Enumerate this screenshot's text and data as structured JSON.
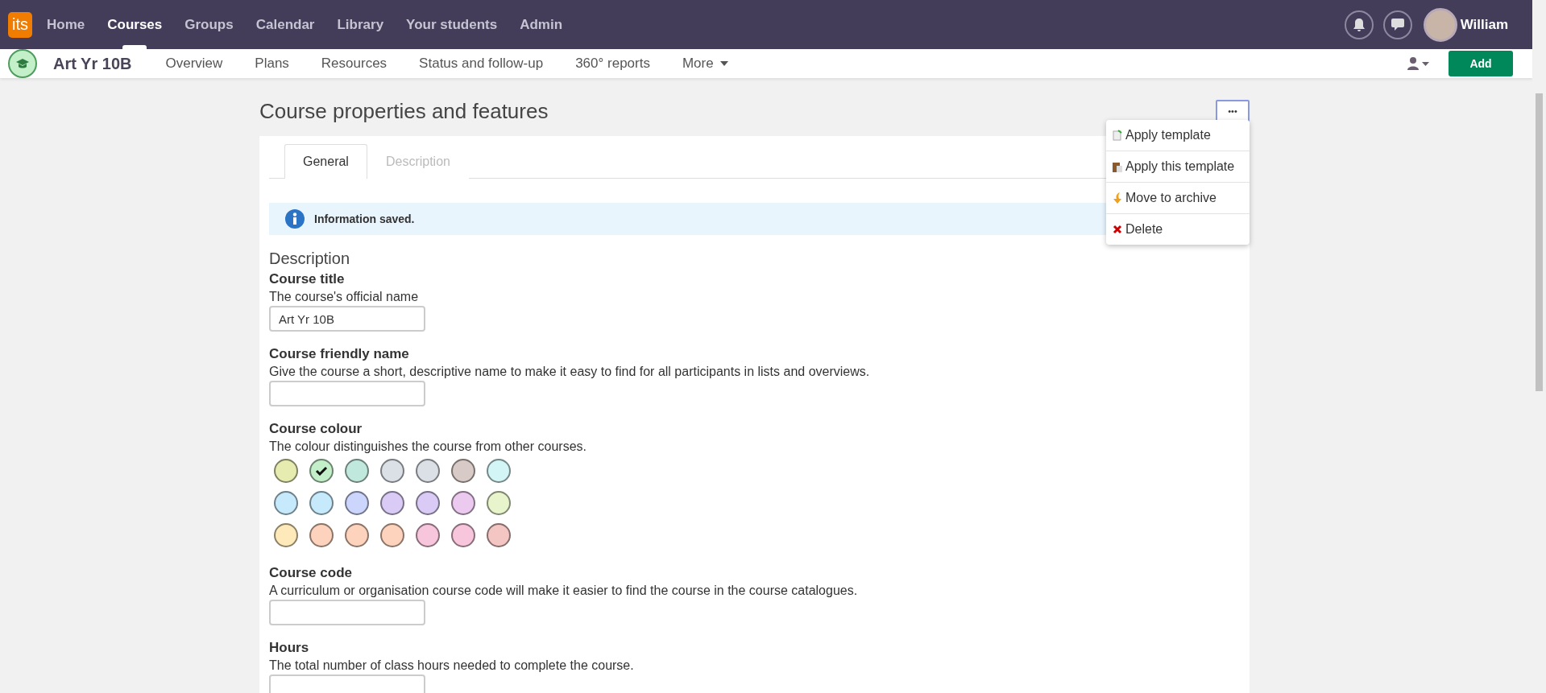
{
  "top_nav": {
    "logo": "its",
    "items": [
      {
        "label": "Home",
        "selected": false
      },
      {
        "label": "Courses",
        "selected": true
      },
      {
        "label": "Groups",
        "selected": false
      },
      {
        "label": "Calendar",
        "selected": false
      },
      {
        "label": "Library",
        "selected": false
      },
      {
        "label": "Your students",
        "selected": false
      },
      {
        "label": "Admin",
        "selected": false
      }
    ],
    "user": "William"
  },
  "course_bar": {
    "title": "Art Yr 10B",
    "links": [
      "Overview",
      "Plans",
      "Resources",
      "Status and follow-up",
      "360° reports",
      "More"
    ],
    "add_button": "Add"
  },
  "page_title": "Course properties and features",
  "more_menu": {
    "button": "•••",
    "items": [
      {
        "label": "Apply template",
        "kind": "template"
      },
      {
        "label": "Apply this template",
        "kind": "clipboard"
      },
      {
        "label": "Move to archive",
        "kind": "archive"
      },
      {
        "label": "Delete",
        "kind": "delete"
      }
    ]
  },
  "tabs": [
    {
      "label": "General",
      "selected": true
    },
    {
      "label": "Description",
      "selected": false
    }
  ],
  "notice": "Information saved.",
  "section_title": "Description",
  "fields": [
    {
      "label": "Course title",
      "help": "The course's official name",
      "value": "Art Yr 10B",
      "kind": "text"
    },
    {
      "label": "Course friendly name",
      "help": "Give the course a short, descriptive name to make it easy to find for all participants in lists and overviews.",
      "kind": "text"
    },
    {
      "label": "Course colour",
      "help": "The colour distinguishes the course from other courses.",
      "kind": "colours",
      "colours": [
        {
          "color": "#e6ebb0",
          "selected": false
        },
        {
          "color": "#c3efc9",
          "selected": true
        },
        {
          "color": "#c0e8dc",
          "selected": false
        },
        {
          "color": "#dae0e6",
          "selected": false
        },
        {
          "color": "#dae0e6",
          "selected": false
        },
        {
          "color": "#d8cbc7",
          "selected": false
        },
        {
          "color": "#d3f5f5",
          "selected": false
        },
        {
          "color": "#c6eafc",
          "selected": false
        },
        {
          "color": "#c6eafc",
          "selected": false
        },
        {
          "color": "#ccd5fc",
          "selected": false
        },
        {
          "color": "#d9cbf5",
          "selected": false
        },
        {
          "color": "#d9cbf5",
          "selected": false
        },
        {
          "color": "#ecc9ee",
          "selected": false
        },
        {
          "color": "#e8f5cc",
          "selected": false
        },
        {
          "color": "#fde9b9",
          "selected": false
        },
        {
          "color": "#fdd3bd",
          "selected": false
        },
        {
          "color": "#fdd3bd",
          "selected": false
        },
        {
          "color": "#fdd3bd",
          "selected": false
        },
        {
          "color": "#f7c6dc",
          "selected": false
        },
        {
          "color": "#f7c6dc",
          "selected": false
        },
        {
          "color": "#f4c6c3",
          "selected": false
        }
      ]
    },
    {
      "label": "Course code",
      "help": "A curriculum or organisation course code will make it easier to find the course in the course catalogues.",
      "kind": "text"
    },
    {
      "label": "Hours",
      "help": "The total number of class hours needed to complete the course.",
      "kind": "text"
    }
  ]
}
